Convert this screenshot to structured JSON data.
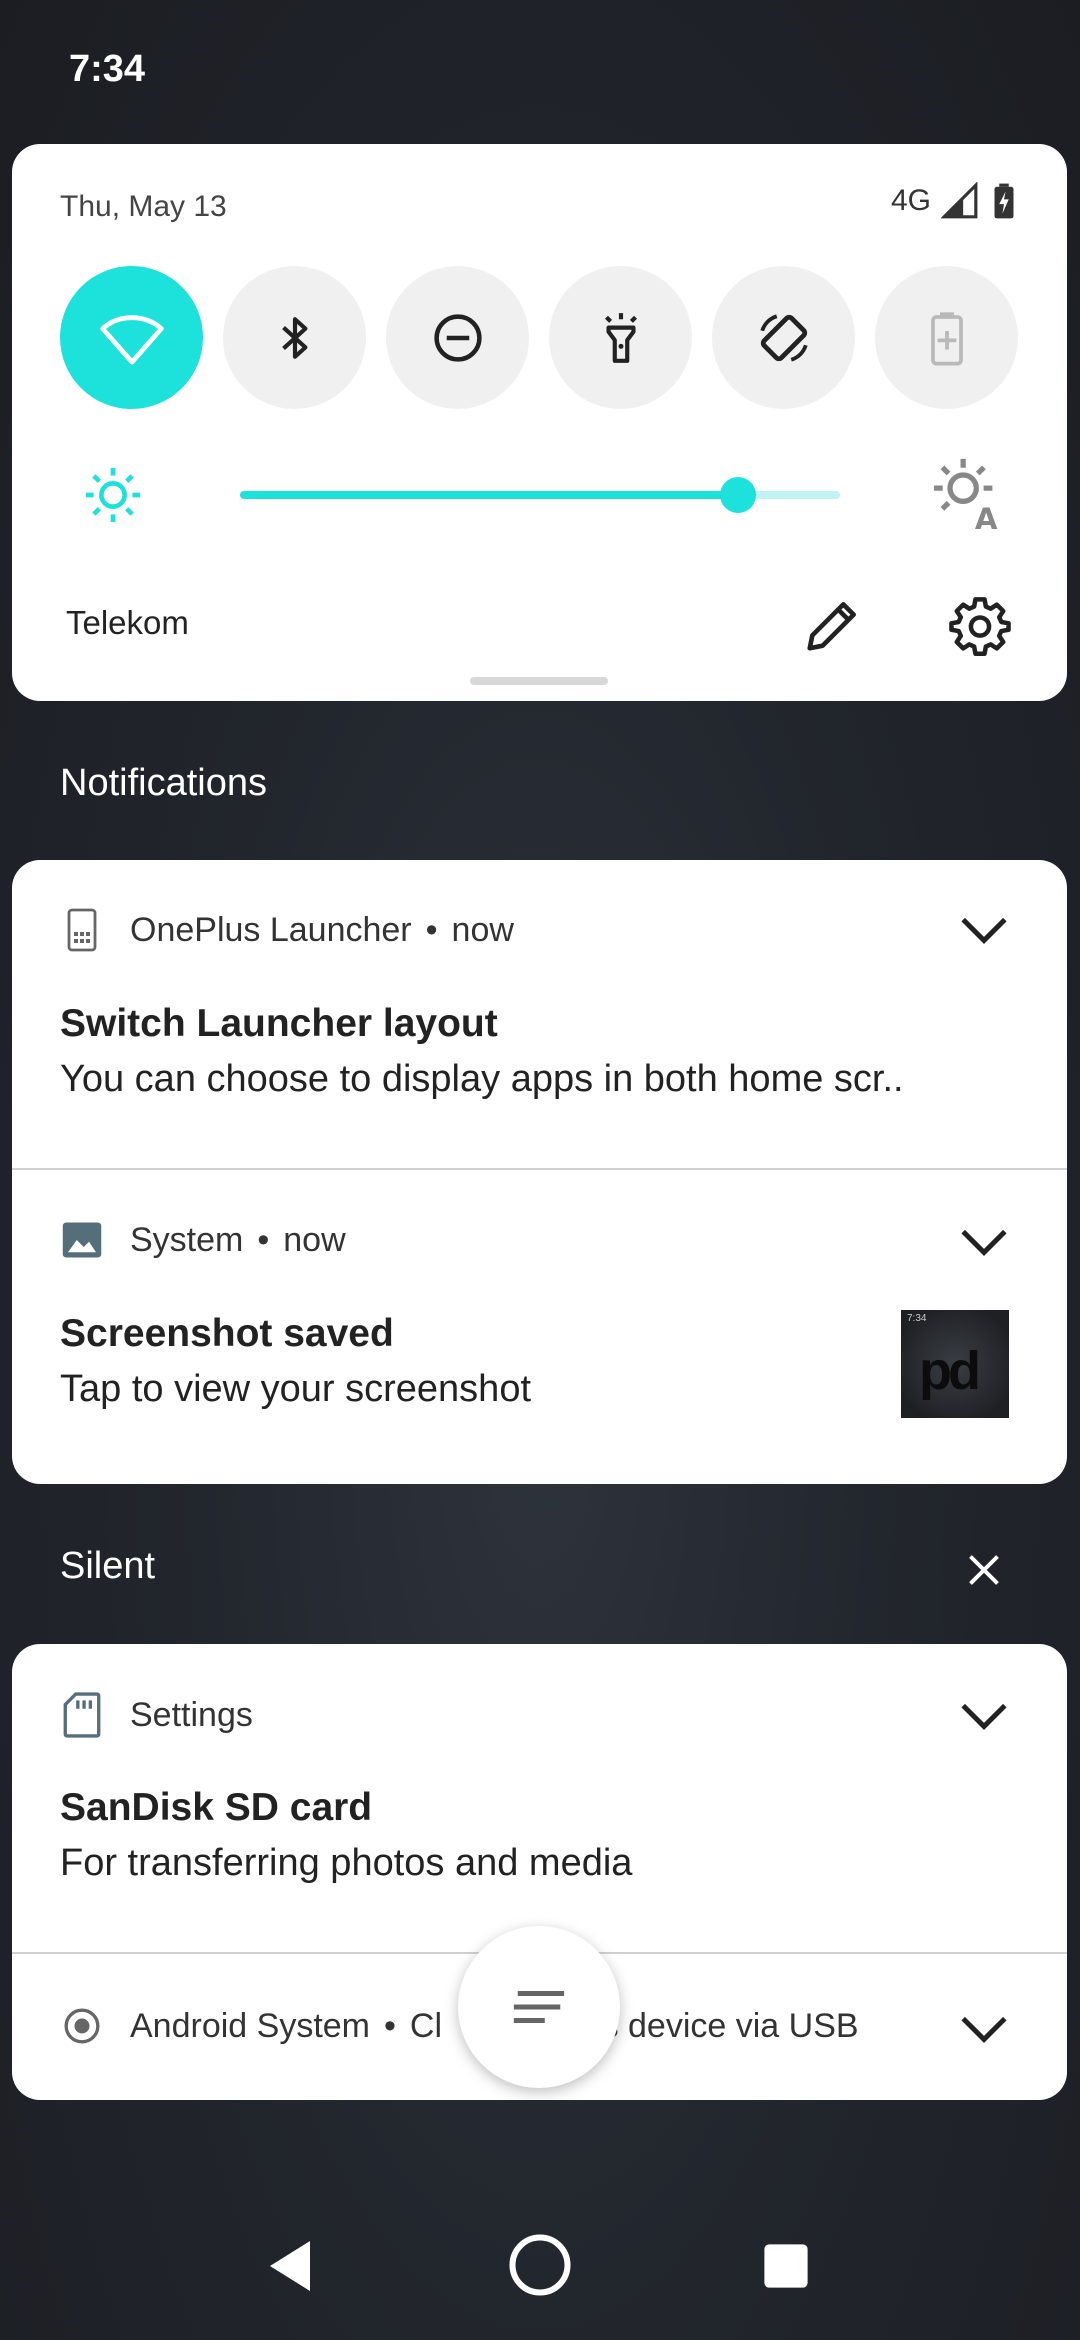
{
  "status_bar": {
    "time": "7:34"
  },
  "quick_settings": {
    "date": "Thu, May 13",
    "network_type": "4G",
    "tiles": [
      {
        "name": "wifi",
        "active": true
      },
      {
        "name": "bluetooth",
        "active": false
      },
      {
        "name": "do-not-disturb",
        "active": false
      },
      {
        "name": "flashlight",
        "active": false
      },
      {
        "name": "auto-rotate",
        "active": false
      },
      {
        "name": "battery-saver",
        "active": false,
        "disabled": true
      }
    ],
    "brightness_level": 0.83,
    "carrier": "Telekom",
    "accent_color": "#1de1db"
  },
  "sections": {
    "notifications": "Notifications",
    "silent": "Silent"
  },
  "notifications": [
    {
      "app": "OnePlus Launcher",
      "time": "now",
      "title": "Switch Launcher layout",
      "text": "You can choose to display apps in both home scr.."
    },
    {
      "app": "System",
      "time": "now",
      "title": "Screenshot saved",
      "text": "Tap to view your screenshot",
      "thumbnail_time": "7:34"
    }
  ],
  "silent_notifications": [
    {
      "app": "Settings",
      "title": "SanDisk SD card",
      "text": "For transferring photos and media"
    },
    {
      "app": "Android System",
      "summary_start": "Cl",
      "summary_end": "is device via USB"
    }
  ]
}
